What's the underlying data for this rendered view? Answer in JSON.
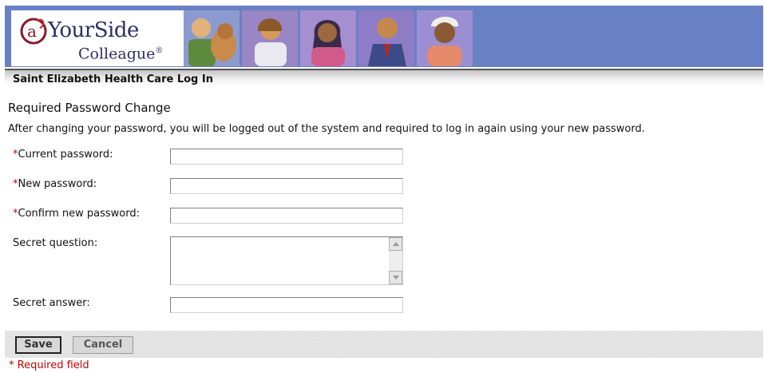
{
  "header": {
    "logo_line1": "YourSide",
    "logo_line2": "Colleague",
    "logo_mark": "®",
    "banner_color": "#6a80c5"
  },
  "titlebar": {
    "title": "Saint Elizabeth Health Care Log In"
  },
  "form": {
    "section_title": "Required Password Change",
    "intro": "After changing your password, you will be logged out of the system and required to log in again using your new password.",
    "required_marker": "*",
    "fields": {
      "current_password": {
        "label": "Current password:",
        "value": ""
      },
      "new_password": {
        "label": "New password:",
        "value": ""
      },
      "confirm_password": {
        "label": "Confirm new password:",
        "value": ""
      },
      "secret_question": {
        "label": "Secret question:",
        "value": ""
      },
      "secret_answer": {
        "label": "Secret answer:",
        "value": ""
      }
    }
  },
  "actions": {
    "save_label": "Save",
    "cancel_label": "Cancel"
  },
  "footer": {
    "required_note": "* Required field"
  },
  "colors": {
    "required": "#cc0000",
    "accent": "#6a80c5"
  }
}
